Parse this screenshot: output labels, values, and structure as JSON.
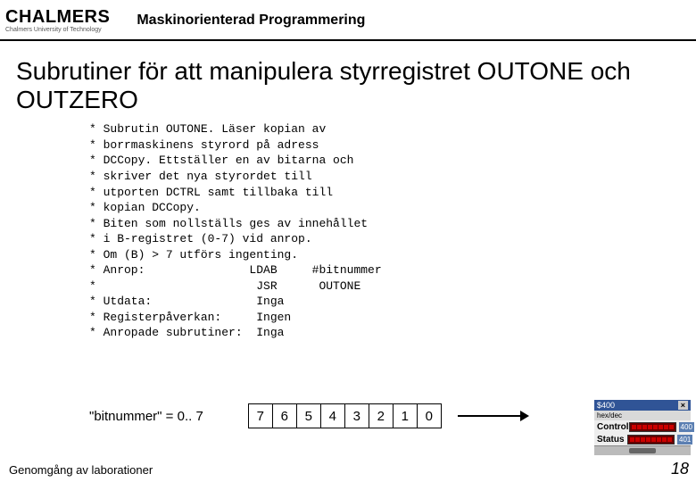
{
  "header": {
    "logo_main": "CHALMERS",
    "logo_sub": "Chalmers University of Technology",
    "course": "Maskinorienterad Programmering"
  },
  "title": "Subrutiner för att manipulera styrregistret OUTONE och OUTZERO",
  "code": "* Subrutin OUTONE. Läser kopian av\n* borrmaskinens styrord på adress\n* DCCopy. Ettställer en av bitarna och\n* skriver det nya styrordet till\n* utporten DCTRL samt tillbaka till\n* kopian DCCopy.\n* Biten som nollställs ges av innehållet\n* i B-registret (0-7) vid anrop.\n* Om (B) > 7 utförs ingenting.\n* Anrop:               LDAB     #bitnummer\n*                       JSR      OUTONE\n* Utdata:               Inga\n* Registerpåverkan:     Ingen\n* Anropade subrutiner:  Inga",
  "bitnum_label": "\"bitnummer\" = 0.. 7",
  "bits": [
    "7",
    "6",
    "5",
    "4",
    "3",
    "2",
    "1",
    "0"
  ],
  "module": {
    "title": "$400",
    "sub": "hex/dec",
    "rows": [
      {
        "label": "Control",
        "addr": "400"
      },
      {
        "label": "Status",
        "addr": "401"
      }
    ]
  },
  "footer": "Genomgång av laborationer",
  "page": "18"
}
